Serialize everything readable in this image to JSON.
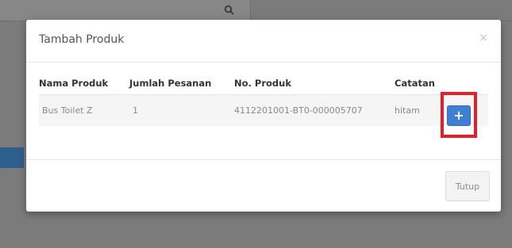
{
  "modal": {
    "title": "Tambah Produk",
    "close_symbol": "×",
    "columns": [
      "Nama Produk",
      "Jumlah Pesanan",
      "No. Produk",
      "Catatan"
    ],
    "rows": [
      {
        "nama_produk": "Bus Toilet Z",
        "jumlah_pesanan": "1",
        "no_produk": "4112201001-BT0-000005707",
        "catatan": "hitam",
        "add_icon": "plus-icon"
      }
    ],
    "footer": {
      "close_label": "Tutup"
    }
  },
  "colors": {
    "accent": "#3c7fd4",
    "highlight": "#e3202a"
  }
}
